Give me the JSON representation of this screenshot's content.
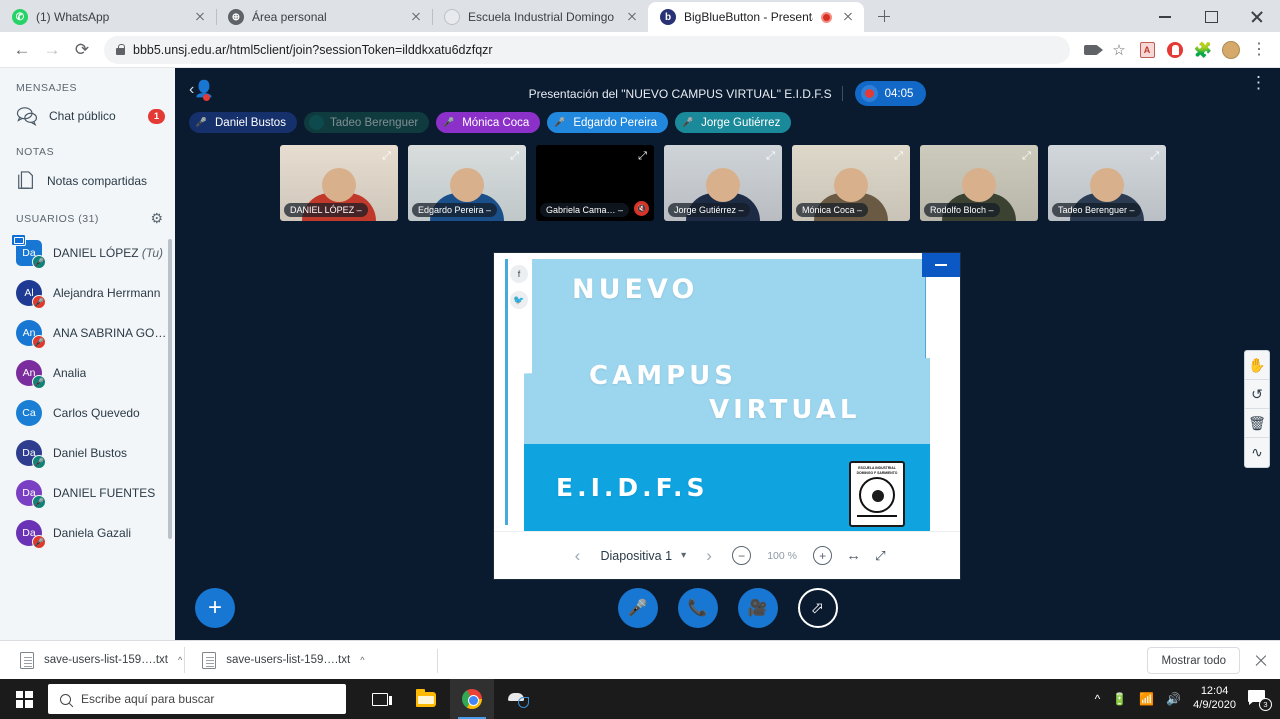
{
  "browser": {
    "tabs": [
      {
        "title": "(1) WhatsApp",
        "favicon": "whatsapp-icon",
        "active": false,
        "recording": false
      },
      {
        "title": "Área personal",
        "favicon": "globe-icon",
        "active": false,
        "recording": false
      },
      {
        "title": "Escuela Industrial Domingo Faust",
        "favicon": "page-icon",
        "active": false,
        "recording": false
      },
      {
        "title": "BigBlueButton - Presentació",
        "favicon": "bbb-icon",
        "active": true,
        "recording": true
      }
    ],
    "new_tab_label": "+",
    "url": "bbb5.unsj.edu.ar/html5client/join?sessionToken=ilddkxatu6dzfqzr",
    "nav": {
      "back": "←",
      "forward": "→",
      "reload": "⟳"
    },
    "toolbar_icons": [
      "camera-icon",
      "bookmark-star-icon",
      "pdf-extension-icon",
      "adblock-icon",
      "extensions-puzzle-icon",
      "profile-avatar",
      "chrome-menu-icon"
    ],
    "window_controls": [
      "minimize",
      "maximize",
      "close"
    ]
  },
  "sidebar": {
    "messages_heading": "MENSAJES",
    "public_chat": {
      "label": "Chat público",
      "badge": "1"
    },
    "notes_heading": "NOTAS",
    "shared_notes": {
      "label": "Notas compartidas"
    },
    "users_heading": "USUARIOS (31)",
    "settings_icon": "gear-icon",
    "users": [
      {
        "initials": "Da",
        "name": "DANIEL LÓPEZ",
        "suffix": "(Tu)",
        "color": "#1877d2",
        "shape": "square",
        "status": "mic",
        "presenter": true
      },
      {
        "initials": "Al",
        "name": "Alejandra Herrmann",
        "suffix": "",
        "color": "#1f3a93",
        "shape": "circle",
        "status": "muted",
        "presenter": false
      },
      {
        "initials": "An",
        "name": "ANA SABRINA GON…",
        "suffix": "",
        "color": "#1877d2",
        "shape": "circle",
        "status": "muted",
        "presenter": false
      },
      {
        "initials": "An",
        "name": "Analia",
        "suffix": "",
        "color": "#7b2d9e",
        "shape": "circle",
        "status": "mic",
        "presenter": false
      },
      {
        "initials": "Ca",
        "name": "Carlos Quevedo",
        "suffix": "",
        "color": "#1a7fd4",
        "shape": "circle",
        "status": "none",
        "presenter": false
      },
      {
        "initials": "Da",
        "name": "Daniel Bustos",
        "suffix": "",
        "color": "#2f3d8f",
        "shape": "circle",
        "status": "mic",
        "presenter": false
      },
      {
        "initials": "Da",
        "name": "DANIEL FUENTES",
        "suffix": "",
        "color": "#7b3fc4",
        "shape": "circle",
        "status": "mic",
        "presenter": false
      },
      {
        "initials": "Da",
        "name": "Daniela Gazali",
        "suffix": "",
        "color": "#6a32b5",
        "shape": "circle",
        "status": "muted",
        "presenter": false
      }
    ]
  },
  "meeting": {
    "hide_nav_icon": "hide-navigation-icon",
    "title": "Presentación del \"NUEVO CAMPUS VIRTUAL\" E.I.D.F.S",
    "recording_time": "04:05",
    "options_icon": "kebab-menu-icon",
    "talkers": [
      {
        "name": "Daniel Bustos",
        "bg": "#16306b",
        "muted": false
      },
      {
        "name": "Tadeo Berenguer",
        "bg": "#0f3b3f",
        "muted": true
      },
      {
        "name": "Mónica Coca",
        "bg": "#8b31c9",
        "muted": false
      },
      {
        "name": "Edgardo Pereira",
        "bg": "#2288dd",
        "muted": false
      },
      {
        "name": "Jorge Gutiérrez",
        "bg": "#1a8a9a",
        "muted": false
      }
    ],
    "webcams": [
      {
        "label": "DANIEL LÓPEZ",
        "muted": false,
        "bg": "#cfc6bb",
        "wall": "#e7ddd0",
        "accent": "#c0392b"
      },
      {
        "label": "Edgardo Pereira",
        "muted": false,
        "bg": "#bfc7c9",
        "wall": "#d9dedd",
        "accent": "#1b4f8a"
      },
      {
        "label": "Gabriela Cama…",
        "muted": true,
        "bg": "#000000",
        "wall": "#000000",
        "accent": "#000000"
      },
      {
        "label": "Jorge Gutiérrez",
        "muted": false,
        "bg": "#b9bdc2",
        "wall": "#cfd4d8",
        "accent": "#1d2b45"
      },
      {
        "label": "Mónica Coca",
        "muted": false,
        "bg": "#c8c3b6",
        "wall": "#ddd8ca",
        "accent": "#6a5a44"
      },
      {
        "label": "Rodolfo Bloch",
        "muted": false,
        "bg": "#b7b6a9",
        "wall": "#cdcbbc",
        "accent": "#3c4232"
      },
      {
        "label": "Tadeo Berenguer",
        "muted": false,
        "bg": "#b9bfc4",
        "wall": "#d2d7db",
        "accent": "#2a3b52"
      }
    ]
  },
  "presentation": {
    "minimize_icon": "minimize-presentation-icon",
    "social_icons": [
      "facebook-icon",
      "twitter-icon"
    ],
    "slide_text": {
      "line1": "NUEVO",
      "line2": "CAMPUS",
      "line3": "VIRTUAL",
      "line4": "E.I.D.F.S"
    },
    "crest_text": "ESCUELA INDUSTRIAL DOMINGO F SARMIENTO",
    "toolbar": {
      "prev_label": "‹",
      "slide_label": "Diapositiva 1",
      "caret": "▾",
      "next_label": "›",
      "zoom_out": "−",
      "zoom_value": "100 %",
      "zoom_in": "+",
      "fit_width": "↔",
      "fullscreen": "⤢"
    }
  },
  "whiteboard_tools": [
    {
      "icon": "hand-pan-icon",
      "glyph": "✋"
    },
    {
      "icon": "undo-icon",
      "glyph": "↺"
    },
    {
      "icon": "trash-icon",
      "glyph": "🗑"
    },
    {
      "icon": "pencil-draw-icon",
      "glyph": "∿"
    }
  ],
  "actions": {
    "add_label": "+",
    "microphone": {
      "icon": "microphone-icon",
      "glyph": "🎤"
    },
    "leave_audio": {
      "icon": "phone-handset-icon",
      "glyph": "📞"
    },
    "webcam": {
      "icon": "video-camera-icon",
      "glyph": "🎥"
    },
    "screenshare": {
      "icon": "screen-share-icon",
      "glyph": "⬀"
    }
  },
  "downloads": {
    "items": [
      {
        "name": "save-users-list-159….txt",
        "caret": "^"
      },
      {
        "name": "save-users-list-159….txt",
        "caret": "^"
      }
    ],
    "show_all_label": "Mostrar todo",
    "close_icon": "close-downloads-icon"
  },
  "taskbar": {
    "start_icon": "windows-start-icon",
    "search_placeholder": "Escribe aquí para buscar",
    "search_icon": "search-icon",
    "apps": [
      {
        "icon": "task-view-icon",
        "active": false
      },
      {
        "icon": "file-explorer-icon",
        "active": false
      },
      {
        "icon": "chrome-icon",
        "active": true
      },
      {
        "icon": "snipping-tool-icon",
        "active": false
      }
    ],
    "tray_icons": [
      "show-hidden-icons",
      "battery-icon",
      "wifi-icon",
      "volume-icon"
    ],
    "time": "12:04",
    "date": "4/9/2020",
    "notification_count": "3"
  }
}
